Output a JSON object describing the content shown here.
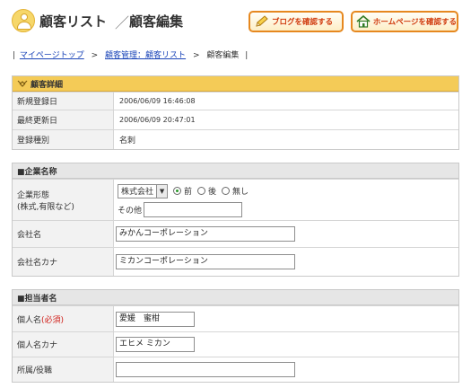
{
  "header": {
    "title": "顧客リスト",
    "separator": "／",
    "subtitle": "顧客編集",
    "blog_button": "ブログを確認する",
    "home_button": "ホームページを確認する"
  },
  "breadcrumb": {
    "lead": "|",
    "items": [
      "マイページトップ",
      "顧客管理：顧客リスト",
      "顧客編集"
    ],
    "sep": ">",
    "tail": "|"
  },
  "customer_detail": {
    "heading": "顧客詳細",
    "rows": [
      {
        "label": "新規登録日",
        "value": "2006/06/09 16:46:08"
      },
      {
        "label": "最終更新日",
        "value": "2006/06/09 20:47:01"
      },
      {
        "label": "登録種別",
        "value": "名刺"
      }
    ]
  },
  "company": {
    "heading": "■企業名称",
    "form_label_1": "企業形態",
    "form_label_2": "(株式,有限など)",
    "form_select": "株式会社",
    "radio_options": [
      "前",
      "後",
      "無し"
    ],
    "radio_selected": "前",
    "other_label": "その他",
    "other_value": "",
    "name_label": "会社名",
    "name_value": "みかんコーポレーション",
    "kana_label": "会社名カナ",
    "kana_value": "ミカンコーポレーション"
  },
  "contact": {
    "heading": "■担当者名",
    "person_label": "個人名",
    "required_mark": "(必須)",
    "person_value": "愛媛　蜜柑",
    "kana_label": "個人名カナ",
    "kana_value": "エヒメ ミカン",
    "dept_label": "所属/役職",
    "dept_value": ""
  }
}
